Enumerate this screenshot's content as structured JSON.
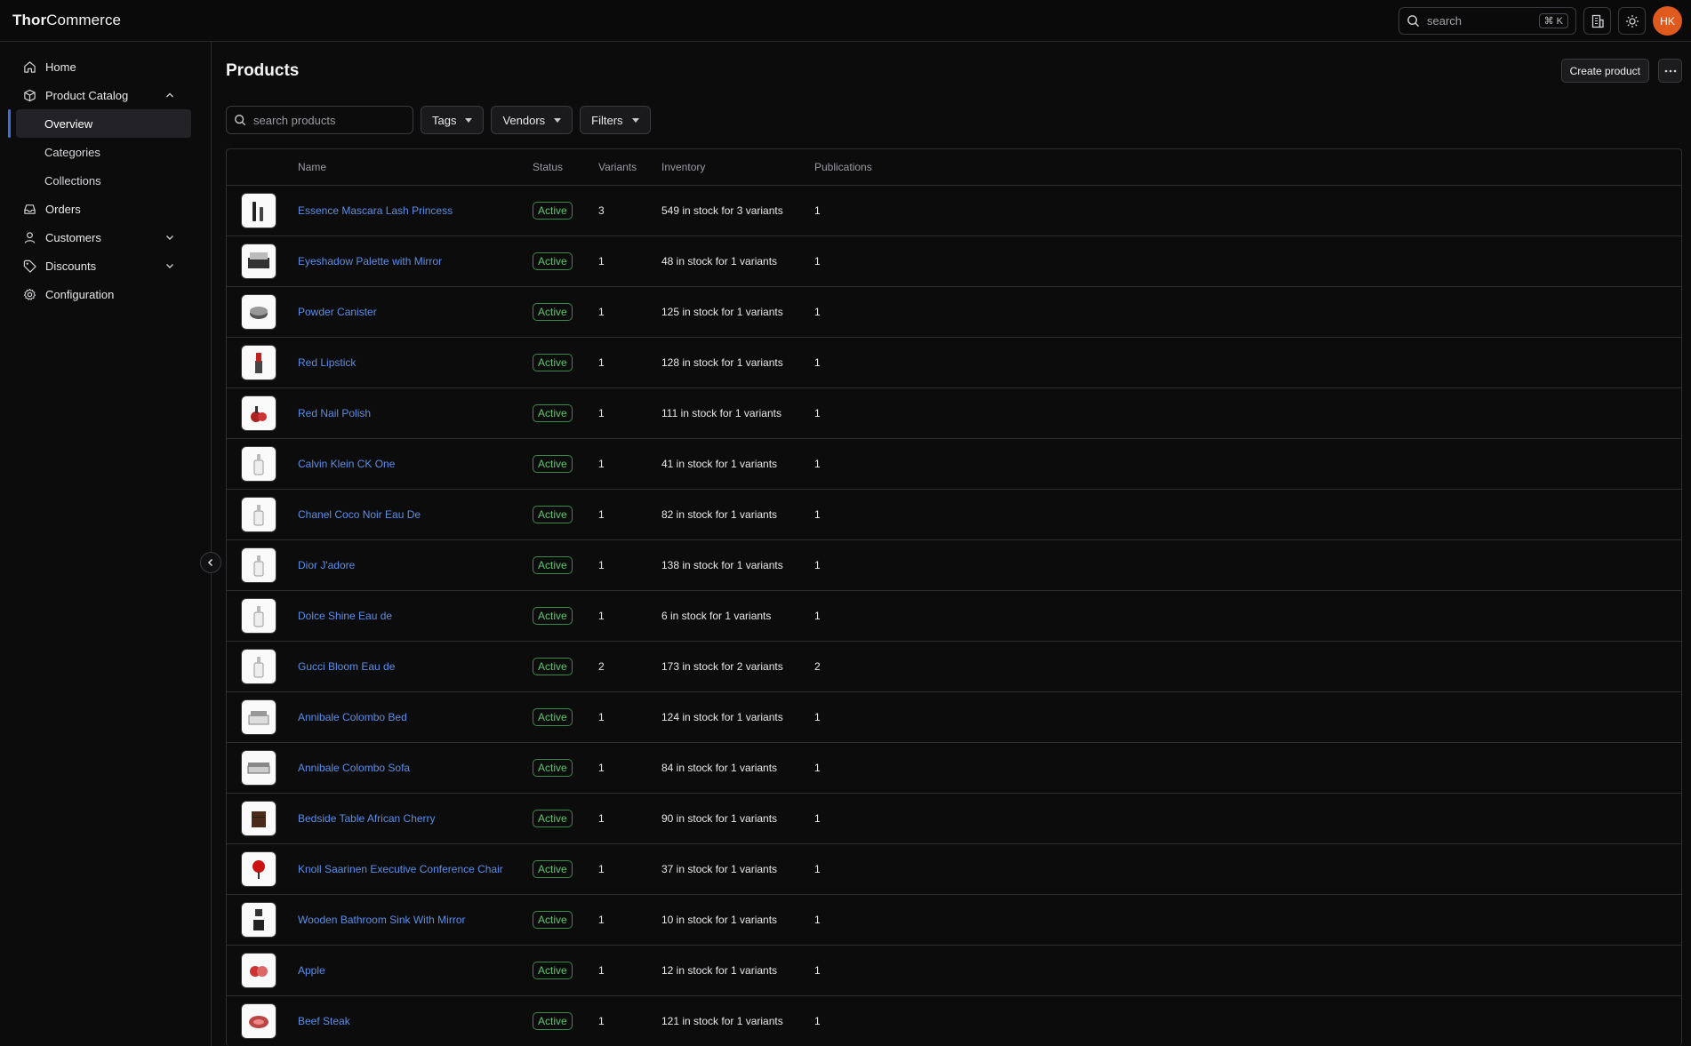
{
  "brand": {
    "bold": "Thor",
    "rest": "Commerce"
  },
  "topbar": {
    "search_placeholder": "search",
    "shortcut": "⌘ K",
    "avatar_initials": "HK"
  },
  "sidebar": {
    "home": "Home",
    "catalog": "Product Catalog",
    "overview": "Overview",
    "categories": "Categories",
    "collections": "Collections",
    "orders": "Orders",
    "customers": "Customers",
    "discounts": "Discounts",
    "configuration": "Configuration"
  },
  "page": {
    "title": "Products",
    "create_label": "Create product"
  },
  "toolbar": {
    "search_placeholder": "search products",
    "tags": "Tags",
    "vendors": "Vendors",
    "filters": "Filters"
  },
  "table": {
    "headers": {
      "name": "Name",
      "status": "Status",
      "variants": "Variants",
      "inventory": "Inventory",
      "publications": "Publications"
    },
    "rows": [
      {
        "name": "Essence Mascara Lash Princess",
        "status": "Active",
        "variants": "3",
        "inventory": "549 in stock for 3 variants",
        "publications": "1",
        "icon": "mascara-thumb"
      },
      {
        "name": "Eyeshadow Palette with Mirror",
        "status": "Active",
        "variants": "1",
        "inventory": "48 in stock for 1 variants",
        "publications": "1",
        "icon": "palette-thumb"
      },
      {
        "name": "Powder Canister",
        "status": "Active",
        "variants": "1",
        "inventory": "125 in stock for 1 variants",
        "publications": "1",
        "icon": "powder-thumb"
      },
      {
        "name": "Red Lipstick",
        "status": "Active",
        "variants": "1",
        "inventory": "128 in stock for 1 variants",
        "publications": "1",
        "icon": "lipstick-thumb"
      },
      {
        "name": "Red Nail Polish",
        "status": "Active",
        "variants": "1",
        "inventory": "111 in stock for 1 variants",
        "publications": "1",
        "icon": "nail-polish-thumb"
      },
      {
        "name": "Calvin Klein CK One",
        "status": "Active",
        "variants": "1",
        "inventory": "41 in stock for 1 variants",
        "publications": "1",
        "icon": "perfume-thumb"
      },
      {
        "name": "Chanel Coco Noir Eau De",
        "status": "Active",
        "variants": "1",
        "inventory": "82 in stock for 1 variants",
        "publications": "1",
        "icon": "perfume-thumb"
      },
      {
        "name": "Dior J'adore",
        "status": "Active",
        "variants": "1",
        "inventory": "138 in stock for 1 variants",
        "publications": "1",
        "icon": "perfume-thumb"
      },
      {
        "name": "Dolce Shine Eau de",
        "status": "Active",
        "variants": "1",
        "inventory": "6 in stock for 1 variants",
        "publications": "1",
        "icon": "perfume-thumb"
      },
      {
        "name": "Gucci Bloom Eau de",
        "status": "Active",
        "variants": "2",
        "inventory": "173 in stock for 2 variants",
        "publications": "2",
        "icon": "perfume-thumb"
      },
      {
        "name": "Annibale Colombo Bed",
        "status": "Active",
        "variants": "1",
        "inventory": "124 in stock for 1 variants",
        "publications": "1",
        "icon": "bed-thumb"
      },
      {
        "name": "Annibale Colombo Sofa",
        "status": "Active",
        "variants": "1",
        "inventory": "84 in stock for 1 variants",
        "publications": "1",
        "icon": "sofa-thumb"
      },
      {
        "name": "Bedside Table African Cherry",
        "status": "Active",
        "variants": "1",
        "inventory": "90 in stock for 1 variants",
        "publications": "1",
        "icon": "table-thumb"
      },
      {
        "name": "Knoll Saarinen Executive Conference Chair",
        "status": "Active",
        "variants": "1",
        "inventory": "37 in stock for 1 variants",
        "publications": "1",
        "icon": "chair-thumb"
      },
      {
        "name": "Wooden Bathroom Sink With Mirror",
        "status": "Active",
        "variants": "1",
        "inventory": "10 in stock for 1 variants",
        "publications": "1",
        "icon": "sink-thumb"
      },
      {
        "name": "Apple",
        "status": "Active",
        "variants": "1",
        "inventory": "12 in stock for 1 variants",
        "publications": "1",
        "icon": "apple-thumb"
      },
      {
        "name": "Beef Steak",
        "status": "Active",
        "variants": "1",
        "inventory": "121 in stock for 1 variants",
        "publications": "1",
        "icon": "steak-thumb"
      }
    ]
  },
  "colors": {
    "accent": "#3b6fe0",
    "link": "#5a8ee8",
    "status_active": "#5fc46e",
    "avatar": "#e05a1e"
  }
}
